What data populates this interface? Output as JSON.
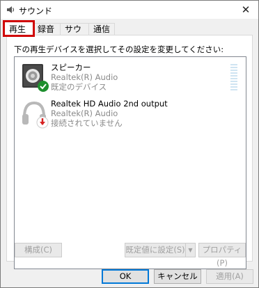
{
  "window": {
    "title": "サウンド",
    "close_glyph": "✕"
  },
  "tabs": [
    {
      "label": "再生",
      "active": true
    },
    {
      "label": "録音",
      "active": false
    },
    {
      "label": "サウンド",
      "active": false
    },
    {
      "label": "通信",
      "active": false
    }
  ],
  "instruction": "下の再生デバイスを選択してその設定を変更してください:",
  "devices": [
    {
      "name": "スピーカー",
      "driver": "Realtek(R) Audio",
      "status": "既定のデバイス",
      "icon": "speaker-icon",
      "badge": "check-badge-icon"
    },
    {
      "name": "Realtek HD Audio 2nd output",
      "driver": "Realtek(R) Audio",
      "status": "接続されていません",
      "icon": "headphones-icon",
      "badge": "down-arrow-badge-icon"
    }
  ],
  "buttons": {
    "configure": "構成(C)",
    "set_default": "既定値に設定(S)",
    "properties": "プロパティ(P)",
    "ok": "OK",
    "cancel": "キャンセル",
    "apply": "適用(A)"
  },
  "colors": {
    "accent": "#0078d7",
    "highlight_box": "#d00000",
    "check_green": "#1e8f2e",
    "badge_red": "#d62222"
  }
}
